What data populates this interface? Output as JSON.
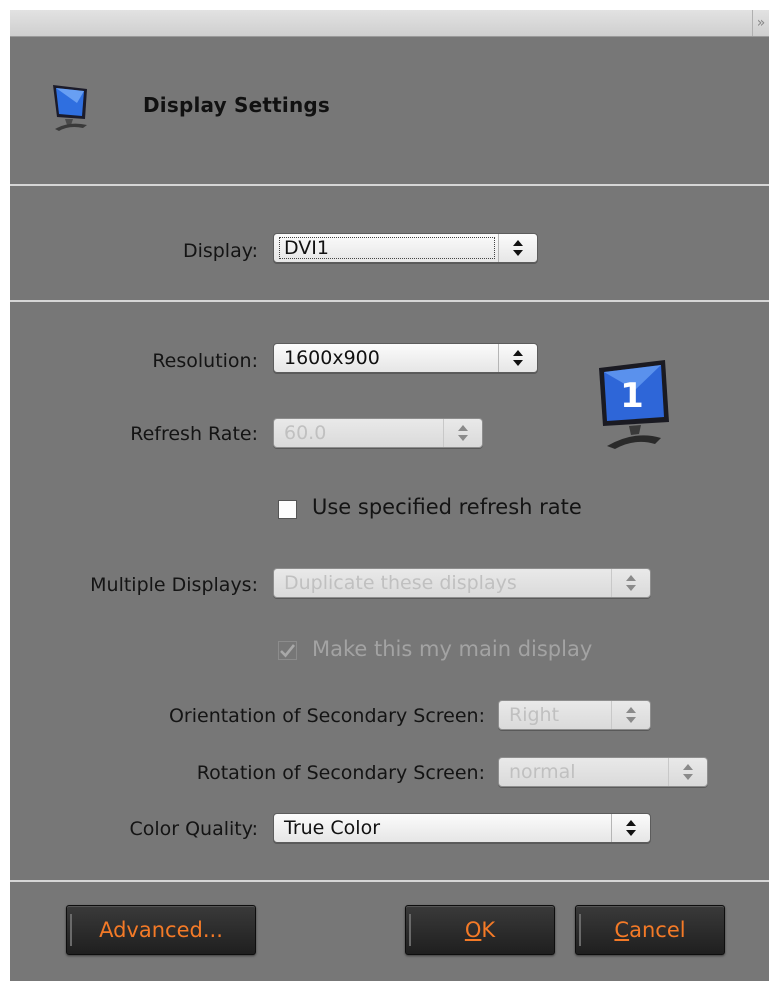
{
  "window": {
    "title": "",
    "close_glyph": "»"
  },
  "header": {
    "title": "Display Settings",
    "icon": "monitor-icon"
  },
  "display": {
    "label": "Display:",
    "value": "DVI1"
  },
  "resolution": {
    "label": "Resolution:",
    "value": "1600x900"
  },
  "refresh_rate": {
    "label": "Refresh Rate:",
    "value": "60.0",
    "enabled": false
  },
  "use_specified_refresh": {
    "label": "Use specified refresh rate",
    "checked": false
  },
  "multiple_displays": {
    "label": "Multiple Displays:",
    "value": "Duplicate these displays",
    "enabled": false
  },
  "main_display": {
    "label": "Make this my main display",
    "checked": true,
    "enabled": false
  },
  "orientation": {
    "label": "Orientation of Secondary Screen:",
    "value": "Right",
    "enabled": false
  },
  "rotation": {
    "label": "Rotation of Secondary Screen:",
    "value": "normal",
    "enabled": false
  },
  "color_quality": {
    "label": "Color Quality:",
    "value": "True Color"
  },
  "monitor_badge": {
    "number": "1",
    "icon": "numbered-monitor-icon"
  },
  "buttons": {
    "advanced": "Advanced...",
    "ok_mnemonic": "O",
    "ok_rest": "K",
    "cancel_mnemonic": "C",
    "cancel_rest": "ancel"
  },
  "colors": {
    "dialog_bg": "#777777",
    "button_text": "#f47a27",
    "separator": "#d6d6d6"
  }
}
